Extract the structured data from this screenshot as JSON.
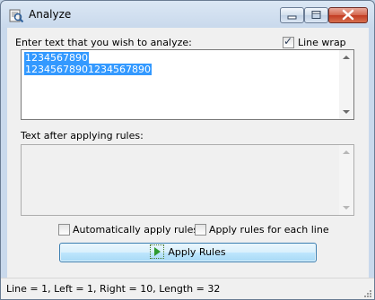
{
  "window": {
    "title": "Analyze"
  },
  "input": {
    "label": "Enter text that you wish to analyze:",
    "line_wrap_label": "Line wrap",
    "line_wrap_checked": true,
    "lines": [
      "1234567890",
      "12345678901234567890"
    ]
  },
  "output": {
    "label": "Text after applying rules:",
    "text": ""
  },
  "options": {
    "auto_apply_label": "Automatically apply rules",
    "auto_apply_checked": false,
    "each_line_label": "Apply rules for each line",
    "each_line_checked": false
  },
  "apply_button": {
    "label": "Apply Rules",
    "icon": "play-icon"
  },
  "status": {
    "text": "Line = 1, Left = 1, Right = 10, Length = 32"
  },
  "colors": {
    "selection": "#3399ff",
    "window_frame": "#c9d9ec",
    "close_button": "#c23b22"
  }
}
